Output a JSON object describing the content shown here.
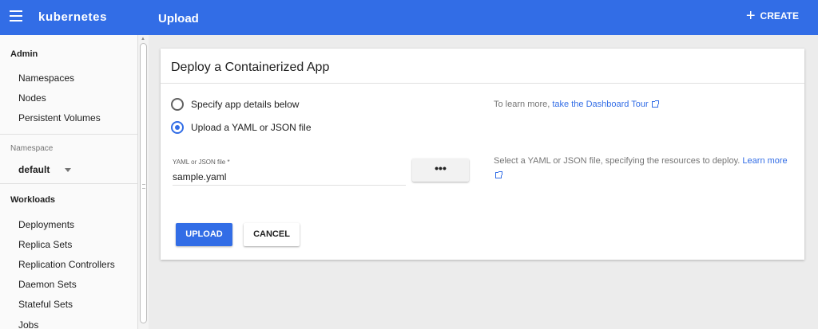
{
  "header": {
    "brand": "kubernetes",
    "page_title": "Upload",
    "create_label": "CREATE",
    "accent_color": "#326de6"
  },
  "sidebar": {
    "admin_heading": "Admin",
    "admin_items": [
      "Namespaces",
      "Nodes",
      "Persistent Volumes"
    ],
    "namespace_label": "Namespace",
    "namespace_value": "default",
    "workloads_heading": "Workloads",
    "workload_items": [
      "Deployments",
      "Replica Sets",
      "Replication Controllers",
      "Daemon Sets",
      "Stateful Sets",
      "Jobs"
    ]
  },
  "card": {
    "title": "Deploy a Containerized App",
    "radio_options": [
      {
        "label": "Specify app details below",
        "checked": false
      },
      {
        "label": "Upload a YAML or JSON file",
        "checked": true
      }
    ],
    "tour_prefix": "To learn more,",
    "tour_link": "take the Dashboard Tour",
    "file_field": {
      "label": "YAML or JSON file *",
      "value": "sample.yaml"
    },
    "browse_label": "•••",
    "file_help_text": "Select a YAML or JSON file, specifying the resources to deploy.",
    "learn_more_link": "Learn more",
    "upload_label": "UPLOAD",
    "cancel_label": "CANCEL"
  }
}
